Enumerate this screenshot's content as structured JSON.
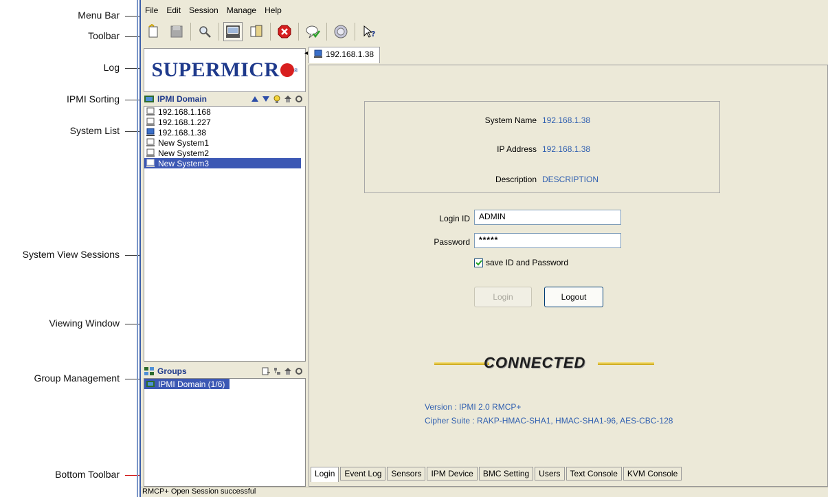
{
  "callouts": [
    {
      "label": "Menu Bar"
    },
    {
      "label": "Toolbar"
    },
    {
      "label": "Log"
    },
    {
      "label": "IPMI Sorting"
    },
    {
      "label": "System List"
    },
    {
      "label": "System View Sessions"
    },
    {
      "label": "Viewing Window"
    },
    {
      "label": "Group Management"
    },
    {
      "label": "Bottom Toolbar"
    }
  ],
  "menu": [
    "File",
    "Edit",
    "Session",
    "Manage",
    "Help"
  ],
  "toolbar": {
    "buttons": [
      "new-icon",
      "save-icon",
      "search-icon",
      "system-view-icon",
      "panel-icon",
      "stop-icon",
      "chat-icon",
      "info-icon",
      "help-pointer-icon"
    ],
    "help_label": "?"
  },
  "logo": {
    "text": "SUPERMICR",
    "reg": "®"
  },
  "ipmi_domain": {
    "header": "IPMI Domain",
    "systems": [
      "192.168.1.168",
      "192.168.1.227",
      "192.168.1.38",
      "New System1",
      "New System2",
      "New System3"
    ],
    "selected_index": 5
  },
  "groups": {
    "header": "Groups",
    "items": [
      "IPMI Domain (1/6)"
    ]
  },
  "session_tab": {
    "label": "192.168.1.38"
  },
  "system_info": {
    "name_label": "System Name",
    "name_value": "192.168.1.38",
    "ip_label": "IP Address",
    "ip_value": "192.168.1.38",
    "desc_label": "Description",
    "desc_value": "DESCRIPTION"
  },
  "login": {
    "id_label": "Login ID",
    "id_value": "ADMIN",
    "password_label": "Password",
    "password_value": "*****",
    "save_label": "save ID and Password",
    "save_checked": true,
    "login_button": "Login",
    "logout_button": "Logout"
  },
  "status": {
    "connected": "CONNECTED",
    "version": "Version : IPMI 2.0 RMCP+",
    "cipher": "Cipher Suite : RAKP-HMAC-SHA1, HMAC-SHA1-96, AES-CBC-128"
  },
  "bottom_tabs": [
    "Login",
    "Event Log",
    "Sensors",
    "IPM Device",
    "BMC Setting",
    "Users",
    "Text Console",
    "KVM Console"
  ],
  "statusbar": {
    "text": "RMCP+ Open Session successful"
  },
  "colors": {
    "accent": "#3c58b4",
    "link": "#2f5fb0",
    "callout_line": "#cc0000",
    "window_bg": "#ece9d8"
  }
}
